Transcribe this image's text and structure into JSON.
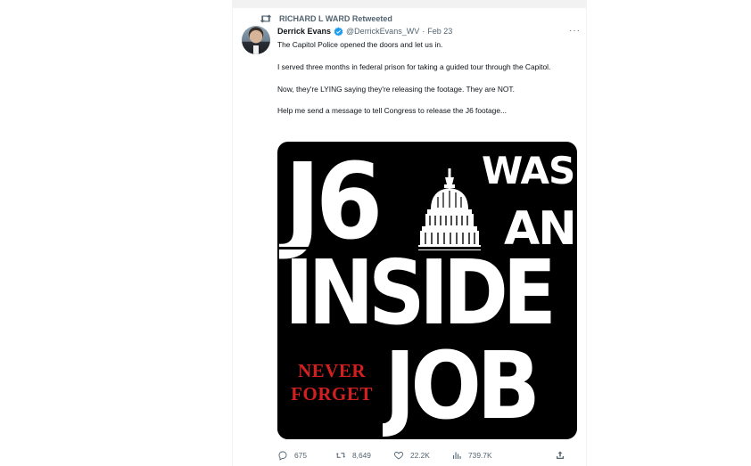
{
  "retweet": {
    "label": "RICHARD L WARD Retweeted",
    "icon": "retweet-icon"
  },
  "author": {
    "display_name": "Derrick Evans",
    "verified_icon": "verified-badge-icon",
    "verified_color": "#1d9bf0",
    "handle": "@DerrickEvans_WV",
    "separator": "·",
    "date": "Feb 23"
  },
  "more_label": "···",
  "body": {
    "paragraphs": [
      "The Capitol Police opened the doors and let us in.",
      "I served three months in federal prison for taking a guided tour through the Capitol.",
      "Now, they're LYING saying they're releasing the footage. They are NOT.",
      "Help me send a message to tell Congress to release the J6 footage..."
    ]
  },
  "media": {
    "line1_left": "J6",
    "line1_right": "WAS",
    "line2_right": "AN",
    "line3": "INSIDE",
    "line4": "JOB",
    "never": "NEVER",
    "forget": "FORGET",
    "background_color": "#000000",
    "text_color": "#ffffff",
    "accent_color": "#d21f1f",
    "image_icon": "capitol-dome-icon"
  },
  "actions": {
    "reply": {
      "icon": "reply-icon",
      "count": "675"
    },
    "retweet": {
      "icon": "retweet-icon",
      "count": "8,649"
    },
    "like": {
      "icon": "heart-icon",
      "count": "22.2K"
    },
    "views": {
      "icon": "views-icon",
      "count": "739.7K"
    },
    "share": {
      "icon": "share-icon"
    }
  }
}
